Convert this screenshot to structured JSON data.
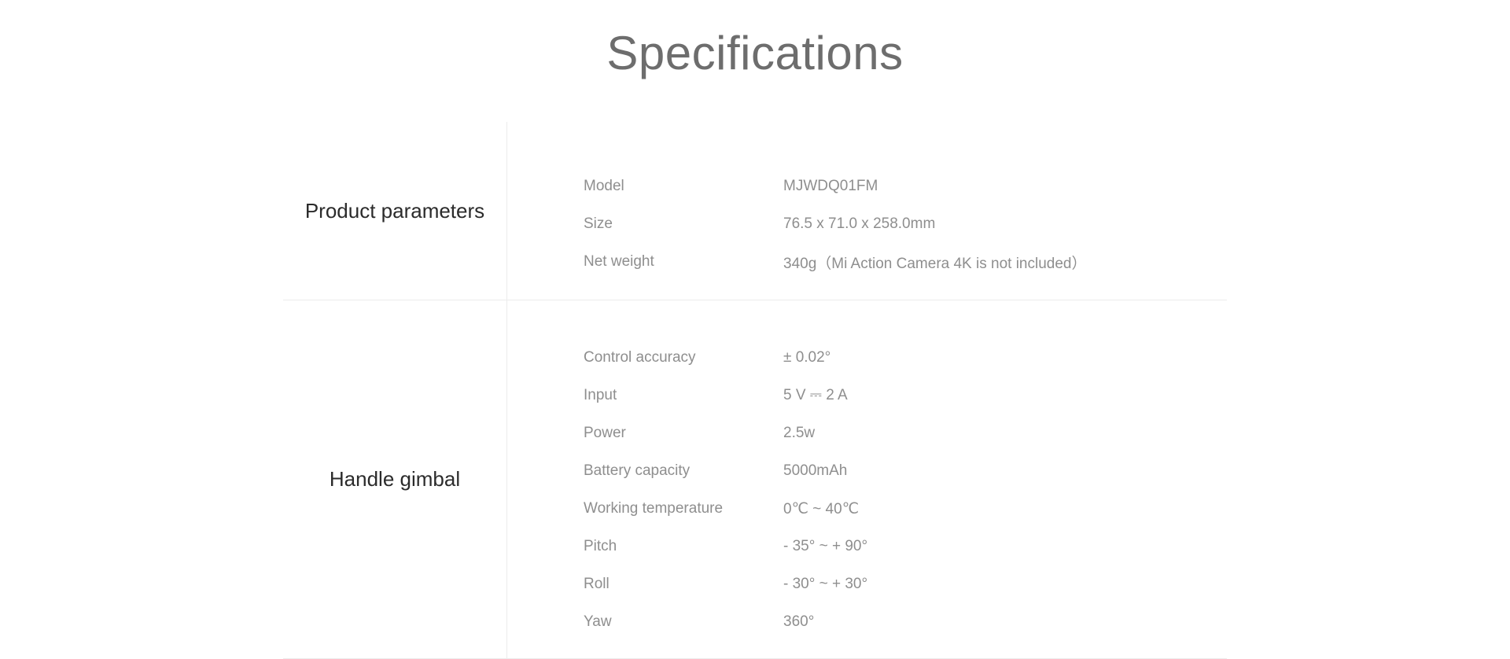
{
  "title": "Specifications",
  "sections": [
    {
      "label": "Product parameters",
      "rows": [
        {
          "key": "Model",
          "value": "MJWDQ01FM"
        },
        {
          "key": "Size",
          "value": "76.5 x 71.0 x 258.0mm"
        },
        {
          "key": "Net weight",
          "value": "340g（Mi Action Camera 4K is not included）"
        }
      ]
    },
    {
      "label": "Handle gimbal",
      "rows": [
        {
          "key": "Control accuracy",
          "value": "± 0.02°"
        },
        {
          "key": "Input",
          "value": "5 V ⎓ 2 A"
        },
        {
          "key": "Power",
          "value": "2.5w"
        },
        {
          "key": "Battery capacity",
          "value": "5000mAh"
        },
        {
          "key": "Working temperature",
          "value": "0℃ ~ 40℃"
        },
        {
          "key": "Pitch",
          "value": "- 35° ~ + 90°"
        },
        {
          "key": "Roll",
          "value": "- 30° ~ + 30°"
        },
        {
          "key": "Yaw",
          "value": "360°"
        }
      ]
    }
  ]
}
